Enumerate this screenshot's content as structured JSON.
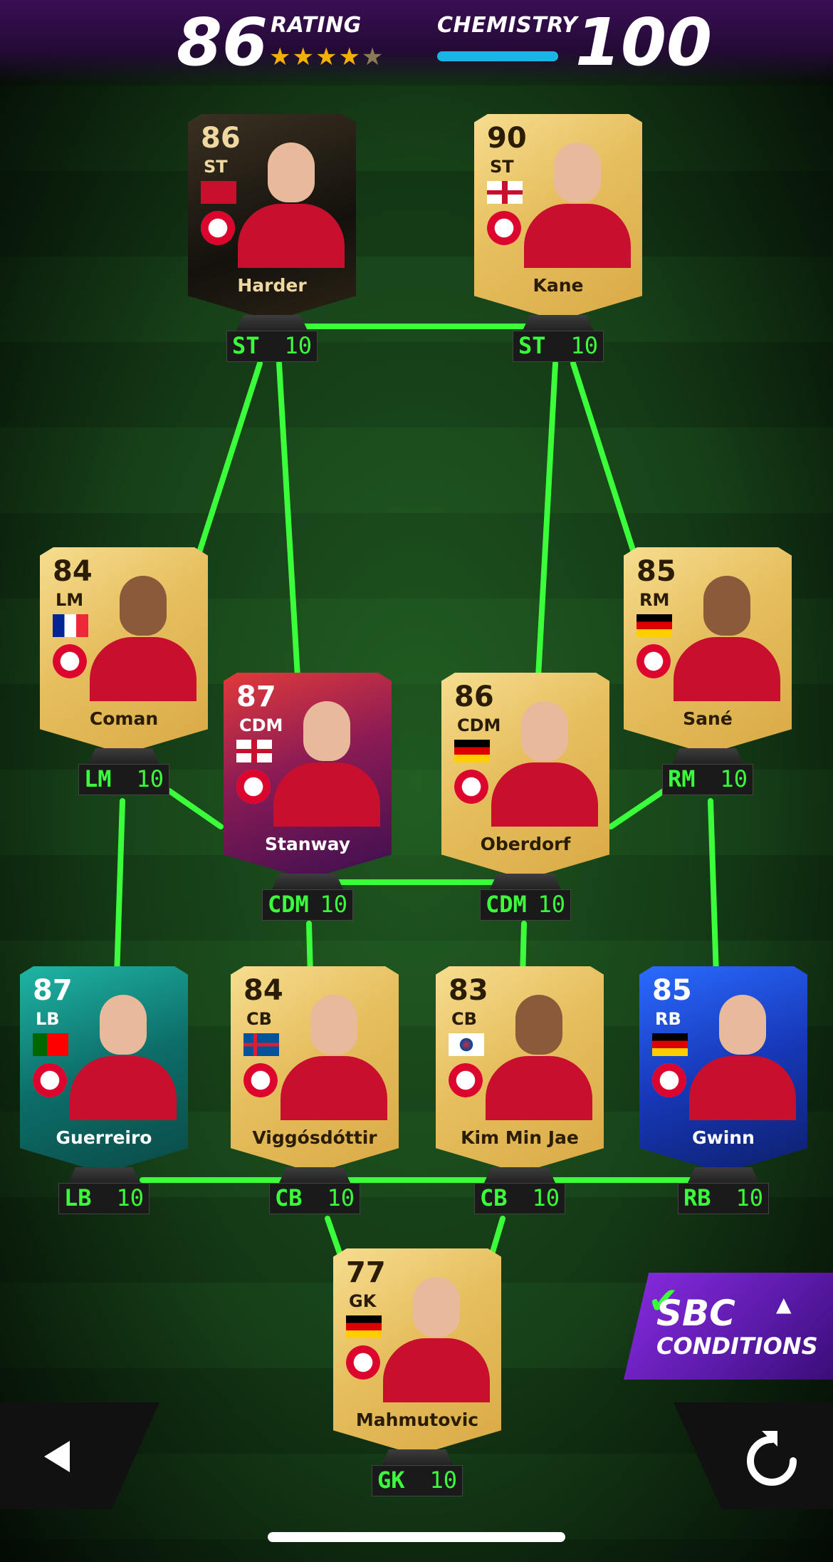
{
  "header": {
    "rating_value": "86",
    "rating_label": "RATING",
    "rating_stars": 4.5,
    "chemistry_label": "CHEMISTRY",
    "chemistry_value": "100",
    "chemistry_bar_fraction": 1.0
  },
  "players": [
    {
      "id": "harder",
      "rating": "86",
      "position": "ST",
      "name": "Harder",
      "flag": "denmark",
      "card_style": "black",
      "slot_pos": "ST",
      "slot_chem": "10"
    },
    {
      "id": "kane",
      "rating": "90",
      "position": "ST",
      "name": "Kane",
      "flag": "england",
      "card_style": "gold",
      "slot_pos": "ST",
      "slot_chem": "10"
    },
    {
      "id": "coman",
      "rating": "84",
      "position": "LM",
      "name": "Coman",
      "flag": "france",
      "card_style": "gold",
      "slot_pos": "LM",
      "slot_chem": "10"
    },
    {
      "id": "sane",
      "rating": "85",
      "position": "RM",
      "name": "Sané",
      "flag": "germany",
      "card_style": "gold",
      "slot_pos": "RM",
      "slot_chem": "10"
    },
    {
      "id": "stanway",
      "rating": "87",
      "position": "CDM",
      "name": "Stanway",
      "flag": "england",
      "card_style": "purple",
      "slot_pos": "CDM",
      "slot_chem": "10"
    },
    {
      "id": "oberdorf",
      "rating": "86",
      "position": "CDM",
      "name": "Oberdorf",
      "flag": "germany",
      "card_style": "gold",
      "slot_pos": "CDM",
      "slot_chem": "10"
    },
    {
      "id": "guerreiro",
      "rating": "87",
      "position": "LB",
      "name": "Guerreiro",
      "flag": "portugal",
      "card_style": "teal",
      "slot_pos": "LB",
      "slot_chem": "10"
    },
    {
      "id": "viggosdottir",
      "rating": "84",
      "position": "CB",
      "name": "Viggósdóttir",
      "flag": "iceland",
      "card_style": "gold",
      "slot_pos": "CB",
      "slot_chem": "10"
    },
    {
      "id": "kimminjae",
      "rating": "83",
      "position": "CB",
      "name": "Kim Min Jae",
      "flag": "south-korea",
      "card_style": "gold",
      "slot_pos": "CB",
      "slot_chem": "10"
    },
    {
      "id": "gwinn",
      "rating": "85",
      "position": "RB",
      "name": "Gwinn",
      "flag": "germany",
      "card_style": "blue",
      "slot_pos": "RB",
      "slot_chem": "10"
    },
    {
      "id": "mahmutovic",
      "rating": "77",
      "position": "GK",
      "name": "Mahmutovic",
      "flag": "germany",
      "card_style": "gold",
      "slot_pos": "GK",
      "slot_chem": "10"
    }
  ],
  "sbc_button": {
    "line1": "SBC",
    "line2": "CONDITIONS"
  },
  "colors": {
    "link_green": "#3aff3a",
    "chem_blue": "#19b5e6",
    "star_gold": "#f4b000",
    "header_purple": "#3a0f55"
  },
  "icons": {
    "back": "back-arrow-icon",
    "reset": "reset-icon",
    "check": "check-icon",
    "caret": "caret-up-icon"
  }
}
